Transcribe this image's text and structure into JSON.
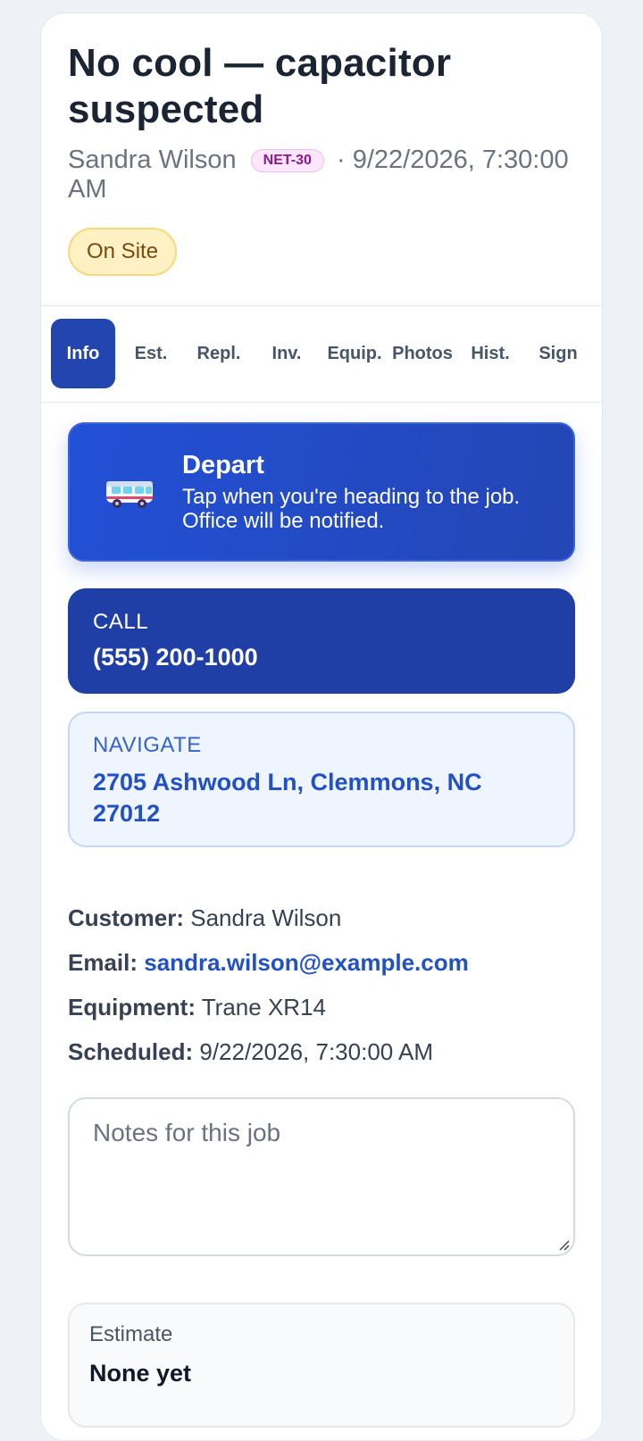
{
  "job": {
    "title": "No cool — capacitor suspected",
    "customer_name": "Sandra Wilson",
    "terms_badge": "NET-30",
    "separator": "·",
    "scheduled_line": "9/22/2026, 7:30:00 AM",
    "status": "On Site"
  },
  "tabs": [
    {
      "label": "Info",
      "active": true
    },
    {
      "label": "Est."
    },
    {
      "label": "Repl."
    },
    {
      "label": "Inv."
    },
    {
      "label": "Equip."
    },
    {
      "label": "Photos"
    },
    {
      "label": "Hist."
    },
    {
      "label": "Sign"
    }
  ],
  "depart": {
    "icon": "van-icon",
    "title": "Depart",
    "text": "Tap when you're heading to the job. Office will be notified."
  },
  "call": {
    "label": "CALL",
    "phone": "(555) 200-1000"
  },
  "navigate": {
    "label": "NAVIGATE",
    "address": "2705 Ashwood Ln, Clemmons, NC 27012"
  },
  "details": {
    "customer_label": "Customer:",
    "customer_value": "Sandra Wilson",
    "email_label": "Email:",
    "email_value": "sandra.wilson@example.com",
    "equipment_label": "Equipment:",
    "equipment_value": "Trane XR14",
    "scheduled_label": "Scheduled:",
    "scheduled_value": "9/22/2026, 7:30:00 AM"
  },
  "notes": {
    "placeholder": "Notes for this job",
    "value": ""
  },
  "estimate": {
    "label": "Estimate",
    "value": "None yet"
  },
  "colors": {
    "primary": "#2345b0",
    "call_bg": "#1f3ea6",
    "status_bg": "#fff1c4",
    "link": "#2251c4"
  }
}
